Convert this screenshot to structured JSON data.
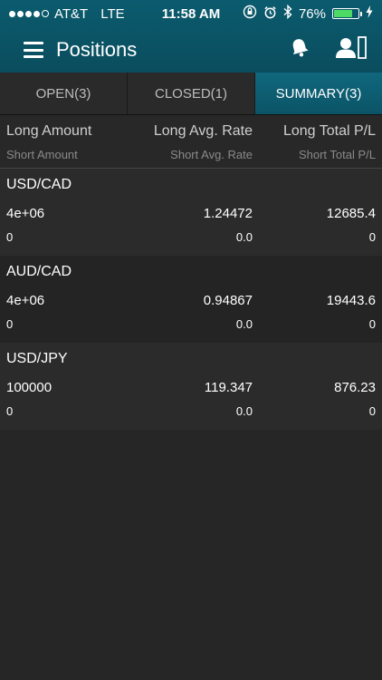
{
  "status_bar": {
    "carrier": "AT&T",
    "network": "LTE",
    "time": "11:58 AM",
    "battery": "76%",
    "battery_level": 0.76
  },
  "nav": {
    "title": "Positions",
    "icons": [
      "menu-icon",
      "bell-icon",
      "account-icon"
    ]
  },
  "tabs": [
    {
      "label": "OPEN(3)"
    },
    {
      "label": "CLOSED(1)"
    },
    {
      "label": "SUMMARY(3)"
    }
  ],
  "columns": {
    "long_amount": "Long Amount",
    "long_avg_rate": "Long Avg. Rate",
    "long_total_pl": "Long Total P/L",
    "short_amount": "Short Amount",
    "short_avg_rate": "Short Avg. Rate",
    "short_total_pl": "Short Total P/L"
  },
  "positions": [
    {
      "pair": "USD/CAD",
      "long_amount": "4e+06",
      "long_avg_rate": "1.24472",
      "long_total_pl": "12685.4",
      "short_amount": "0",
      "short_avg_rate": "0.0",
      "short_total_pl": "0"
    },
    {
      "pair": "AUD/CAD",
      "long_amount": "4e+06",
      "long_avg_rate": "0.94867",
      "long_total_pl": "19443.6",
      "short_amount": "0",
      "short_avg_rate": "0.0",
      "short_total_pl": "0"
    },
    {
      "pair": "USD/JPY",
      "long_amount": "100000",
      "long_avg_rate": "119.347",
      "long_total_pl": "876.23",
      "short_amount": "0",
      "short_avg_rate": "0.0",
      "short_total_pl": "0"
    }
  ],
  "colors": {
    "header_bg": "#0b5b6e",
    "active_tab": "#10677d",
    "battery_fill": "#4cd964",
    "background": "#262626"
  }
}
